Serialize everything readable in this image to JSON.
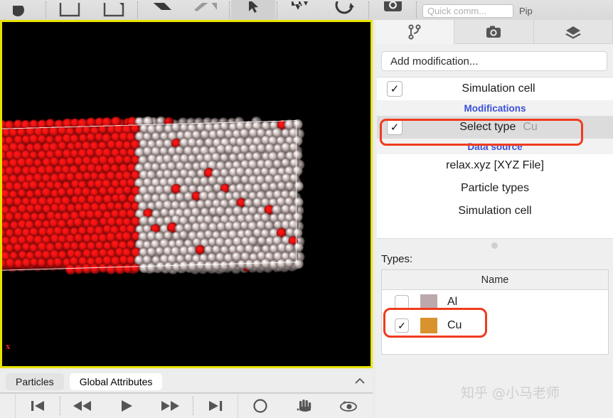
{
  "toolbar": {
    "buttons": [
      {
        "name": "render-active-viewport-icon",
        "glyph": "circle-dark"
      },
      {
        "name": "new-file-icon",
        "glyph": "square"
      },
      {
        "name": "open-file-icon",
        "glyph": "square-arrow"
      },
      {
        "name": "undo-icon",
        "glyph": "undo-arrow"
      },
      {
        "name": "redo-icon",
        "glyph": "redo-arrow"
      },
      {
        "name": "select-mode-icon",
        "glyph": "cursor"
      },
      {
        "name": "move-mode-icon",
        "glyph": "move-arrows"
      },
      {
        "name": "rotate-mode-icon",
        "glyph": "rotate-arc"
      },
      {
        "name": "render-camera-icon",
        "glyph": "camera-filled"
      }
    ],
    "quick_command_placeholder": "Quick comm...",
    "pipelines_label": "Pip"
  },
  "viewport": {
    "axis_label": "x",
    "background_color": "#000000",
    "active_border_color": "#e8e400",
    "selected_particle_color": "#ee1111",
    "unselected_particle_color": "#cbbcba"
  },
  "data_inspector": {
    "tabs": [
      {
        "label": "Particles",
        "selected": false
      },
      {
        "label": "Global Attributes",
        "selected": true
      }
    ],
    "collapse_icon": "chevron-up-icon"
  },
  "playback": {
    "buttons": [
      {
        "name": "skip-to-start-button",
        "glyph": "skip-start"
      },
      {
        "name": "step-back-button",
        "glyph": "rewind"
      },
      {
        "name": "play-button",
        "glyph": "play"
      },
      {
        "name": "step-forward-button",
        "glyph": "fast-forward"
      },
      {
        "name": "skip-to-end-button",
        "glyph": "skip-end"
      },
      {
        "name": "zoom-tool-button",
        "glyph": "circle"
      },
      {
        "name": "pan-tool-button",
        "glyph": "hand"
      },
      {
        "name": "orbit-tool-button",
        "glyph": "orbit-eye"
      }
    ]
  },
  "command_panel": {
    "tabs": [
      {
        "name": "pipeline-tab",
        "icon": "pipeline-branch-icon",
        "selected": true
      },
      {
        "name": "rendering-tab",
        "icon": "camera-icon",
        "selected": false
      },
      {
        "name": "overlays-tab",
        "icon": "layers-icon",
        "selected": false
      }
    ],
    "add_modification_label": "Add modification...",
    "pipeline": [
      {
        "kind": "item",
        "label": "Simulation cell",
        "checked": true,
        "selected": false,
        "value": ""
      },
      {
        "kind": "section",
        "label": "Modifications"
      },
      {
        "kind": "item",
        "label": "Select type",
        "checked": true,
        "selected": true,
        "value": "Cu"
      },
      {
        "kind": "section",
        "label": "Data source"
      },
      {
        "kind": "leaf",
        "label": "relax.xyz [XYZ File]"
      },
      {
        "kind": "leaf",
        "label": "Particle types"
      },
      {
        "kind": "leaf",
        "label": "Simulation cell"
      }
    ],
    "types_label": "Types:",
    "types_column_header": "Name",
    "types": [
      {
        "name": "Al",
        "checked": false,
        "color": "#bda9ab"
      },
      {
        "name": "Cu",
        "checked": true,
        "color": "#d8932f"
      }
    ],
    "highlight_color": "#ef3b1e"
  },
  "watermark": "知乎 @小马老师"
}
